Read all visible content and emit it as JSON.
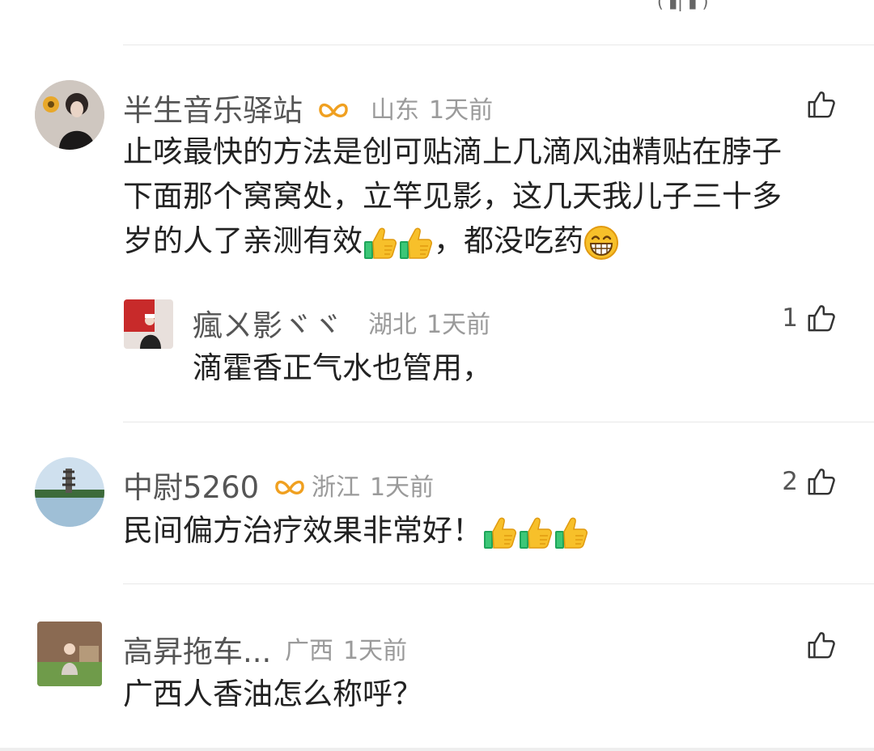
{
  "top_fragment": "( ▮| ▮ )",
  "comments": [
    {
      "name": "半生音乐驿站",
      "location": "山东",
      "time": "1天前",
      "text_lines": [
        "止咳最快的方法是创可贴滴上几滴风油精贴在脖子",
        "下面那个窝窝处，立竿见影，这几天我儿子三十多",
        "岁的人了亲测有效",
        "，都没吃药"
      ],
      "like_count": ""
    },
    {
      "name": "瘋ㄨ影ヾヾ",
      "location": "湖北",
      "time": "1天前",
      "text": "滴霍香正气水也管用，",
      "like_count": "1"
    },
    {
      "name": "中尉5260",
      "location": "浙江",
      "time": "1天前",
      "text": "民间偏方治疗效果非常好！",
      "like_count": "2"
    },
    {
      "name": "高昇拖车...",
      "location": "广西",
      "time": "1天前",
      "text": "广西人香油怎么称呼？",
      "like_count": ""
    }
  ],
  "colors": {
    "name": "#555555",
    "meta": "#9a9a9a",
    "text": "#222222",
    "vip_badge": "#f0a020",
    "divider": "#e8e8e8"
  }
}
